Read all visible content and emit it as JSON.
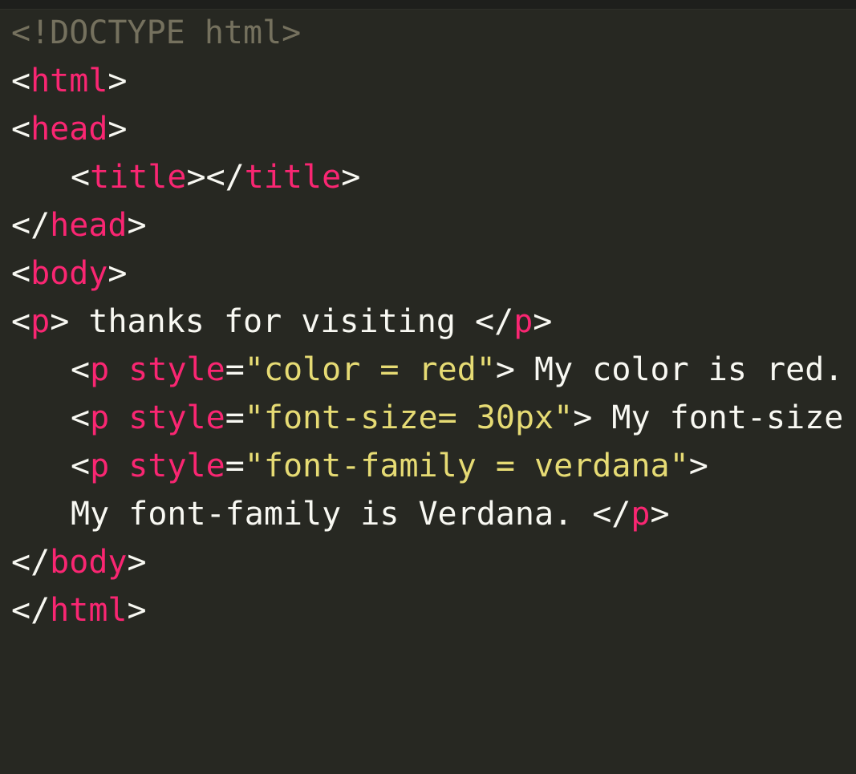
{
  "editor": {
    "theme_colors": {
      "background": "#272822",
      "punctuation": "#f8f8f2",
      "tag": "#f92672",
      "attribute": "#f92672",
      "string": "#e6db74",
      "text": "#f8f8f2",
      "doctype": "#75715e"
    },
    "lines": [
      {
        "indent": 0,
        "tokens": [
          {
            "t": "doctype",
            "v": "<!DOCTYPE html>"
          }
        ]
      },
      {
        "indent": 0,
        "tokens": [
          {
            "t": "punct",
            "v": "<"
          },
          {
            "t": "tag",
            "v": "html"
          },
          {
            "t": "punct",
            "v": ">"
          }
        ]
      },
      {
        "indent": 0,
        "tokens": [
          {
            "t": "punct",
            "v": "<"
          },
          {
            "t": "tag",
            "v": "head"
          },
          {
            "t": "punct",
            "v": ">"
          }
        ]
      },
      {
        "indent": 1,
        "tokens": [
          {
            "t": "punct",
            "v": "<"
          },
          {
            "t": "tag",
            "v": "title"
          },
          {
            "t": "punct",
            "v": "></"
          },
          {
            "t": "tag",
            "v": "title"
          },
          {
            "t": "punct",
            "v": ">"
          }
        ]
      },
      {
        "indent": 0,
        "tokens": [
          {
            "t": "punct",
            "v": "</"
          },
          {
            "t": "tag",
            "v": "head"
          },
          {
            "t": "punct",
            "v": ">"
          }
        ]
      },
      {
        "indent": 0,
        "tokens": [
          {
            "t": "punct",
            "v": "<"
          },
          {
            "t": "tag",
            "v": "body"
          },
          {
            "t": "punct",
            "v": ">"
          }
        ]
      },
      {
        "indent": 0,
        "tokens": [
          {
            "t": "punct",
            "v": "<"
          },
          {
            "t": "tag",
            "v": "p"
          },
          {
            "t": "punct",
            "v": ">"
          },
          {
            "t": "text",
            "v": " thanks for visiting "
          },
          {
            "t": "punct",
            "v": "</"
          },
          {
            "t": "tag",
            "v": "p"
          },
          {
            "t": "punct",
            "v": ">"
          }
        ]
      },
      {
        "indent": 1,
        "tokens": [
          {
            "t": "punct",
            "v": "<"
          },
          {
            "t": "tag",
            "v": "p"
          },
          {
            "t": "text",
            "v": " "
          },
          {
            "t": "attr",
            "v": "style"
          },
          {
            "t": "punct",
            "v": "="
          },
          {
            "t": "str",
            "v": "\"color = red\""
          },
          {
            "t": "punct",
            "v": ">"
          },
          {
            "t": "text",
            "v": " My color is red."
          }
        ]
      },
      {
        "indent": 1,
        "tokens": [
          {
            "t": "punct",
            "v": "<"
          },
          {
            "t": "tag",
            "v": "p"
          },
          {
            "t": "text",
            "v": " "
          },
          {
            "t": "attr",
            "v": "style"
          },
          {
            "t": "punct",
            "v": "="
          },
          {
            "t": "str",
            "v": "\"font-size= 30px\""
          },
          {
            "t": "punct",
            "v": ">"
          },
          {
            "t": "text",
            "v": " My font-size"
          }
        ]
      },
      {
        "indent": 1,
        "tokens": [
          {
            "t": "punct",
            "v": "<"
          },
          {
            "t": "tag",
            "v": "p"
          },
          {
            "t": "text",
            "v": " "
          },
          {
            "t": "attr",
            "v": "style"
          },
          {
            "t": "punct",
            "v": "="
          },
          {
            "t": "str",
            "v": "\"font-family = verdana\""
          },
          {
            "t": "punct",
            "v": ">"
          }
        ]
      },
      {
        "indent": 1,
        "tokens": [
          {
            "t": "text",
            "v": "My font-family is Verdana. "
          },
          {
            "t": "punct",
            "v": "</"
          },
          {
            "t": "tag",
            "v": "p"
          },
          {
            "t": "punct",
            "v": ">"
          }
        ]
      },
      {
        "indent": 0,
        "tokens": [
          {
            "t": "punct",
            "v": "</"
          },
          {
            "t": "tag",
            "v": "body"
          },
          {
            "t": "punct",
            "v": ">"
          }
        ]
      },
      {
        "indent": 0,
        "tokens": [
          {
            "t": "punct",
            "v": "</"
          },
          {
            "t": "tag",
            "v": "html"
          },
          {
            "t": "punct",
            "v": ">"
          }
        ]
      }
    ]
  }
}
